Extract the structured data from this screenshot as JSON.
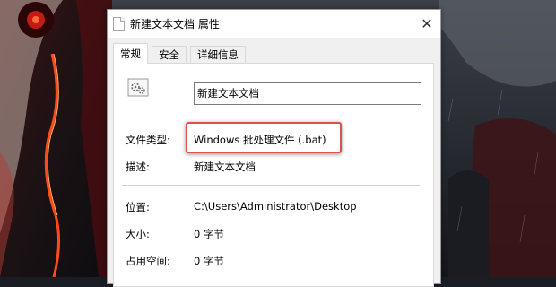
{
  "window": {
    "title": "新建文本文档 属性",
    "close_glyph": "✕"
  },
  "tabs": [
    {
      "label": "常规",
      "active": true
    },
    {
      "label": "安全",
      "active": false
    },
    {
      "label": "详细信息",
      "active": false
    }
  ],
  "general": {
    "file_name": "新建文本文档",
    "type_label": "文件类型:",
    "type_value": "Windows 批处理文件 (.bat)",
    "desc_label": "描述:",
    "desc_value": "新建文本文档",
    "location_label": "位置:",
    "location_value": "C:\\Users\\Administrator\\Desktop",
    "size_label": "大小:",
    "size_value": "0 字节",
    "disk_label": "占用空间:",
    "disk_value": "0 字节"
  },
  "icons": {
    "file_icon": "gear-document-icon",
    "title_icon": "document-icon",
    "close_icon": "close-icon"
  },
  "colors": {
    "highlight_border": "#d9534f",
    "dialog_bg": "#f0f0f0",
    "panel_bg": "#ffffff"
  }
}
